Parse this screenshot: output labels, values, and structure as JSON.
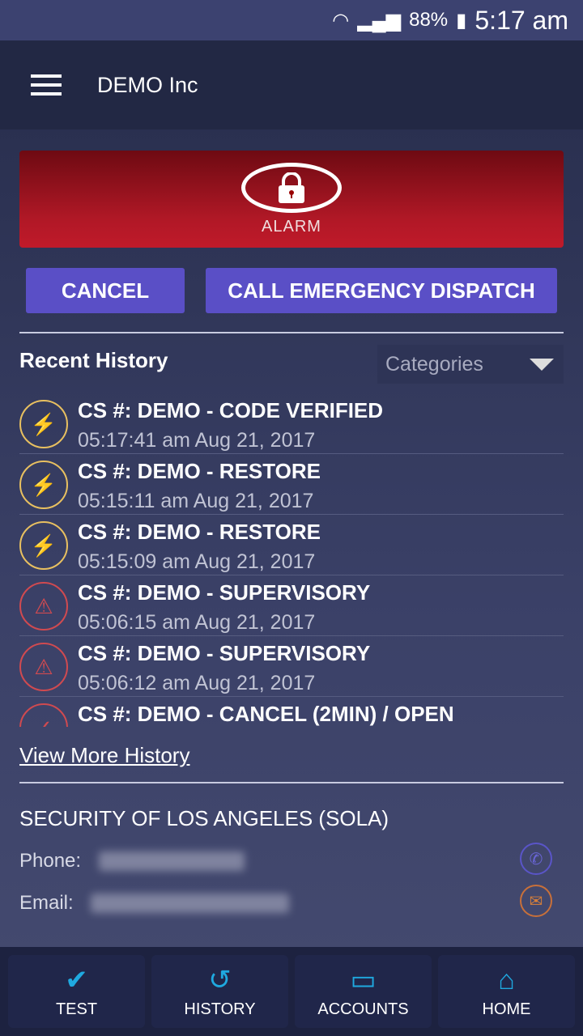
{
  "status": {
    "battery": "88%",
    "time": "5:17 am"
  },
  "appbar": {
    "title": "DEMO Inc"
  },
  "alarm": {
    "label": "ALARM"
  },
  "buttons": {
    "cancel": "CANCEL",
    "dispatch": "CALL EMERGENCY DISPATCH"
  },
  "history": {
    "title": "Recent History",
    "categories": "Categories",
    "view_more": "View More History",
    "items": [
      {
        "icon": "lightning-icon",
        "title": "CS #: DEMO - CODE VERIFIED",
        "time": "05:17:41 am Aug 21, 2017",
        "color": "#e8c060"
      },
      {
        "icon": "lightning-icon",
        "title": "CS #: DEMO - RESTORE",
        "time": "05:15:11 am Aug 21, 2017",
        "color": "#e8c060"
      },
      {
        "icon": "lightning-icon",
        "title": "CS #: DEMO - RESTORE",
        "time": "05:15:09 am Aug 21, 2017",
        "color": "#e8c060"
      },
      {
        "icon": "warning-icon",
        "title": "CS #: DEMO - SUPERVISORY",
        "time": "05:06:15 am Aug 21, 2017",
        "color": "#d04a50"
      },
      {
        "icon": "warning-icon",
        "title": "CS #: DEMO - SUPERVISORY",
        "time": "05:06:12 am Aug 21, 2017",
        "color": "#d04a50"
      },
      {
        "icon": "check-icon",
        "title": "CS #: DEMO - CANCEL (2MIN) / OPEN",
        "time": "",
        "color": "#d04a50"
      }
    ]
  },
  "company": {
    "name": "SECURITY OF LOS ANGELES (SOLA)",
    "phone_label": "Phone:",
    "email_label": "Email:"
  },
  "nav": [
    {
      "label": "TEST",
      "icon": "check-circle-icon"
    },
    {
      "label": "HISTORY",
      "icon": "history-icon"
    },
    {
      "label": "ACCOUNTS",
      "icon": "card-icon"
    },
    {
      "label": "HOME",
      "icon": "home-icon"
    }
  ]
}
